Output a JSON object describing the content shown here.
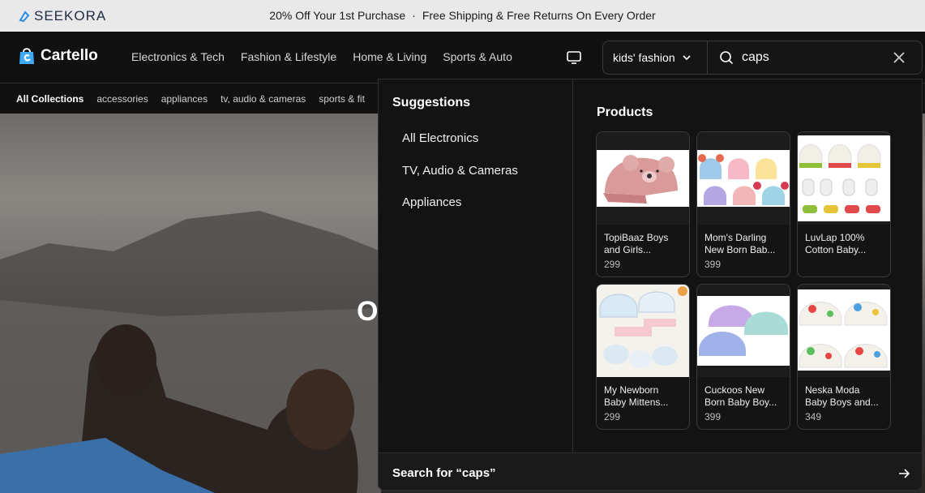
{
  "announcement": {
    "brand": "SEEKORA",
    "promo": "20% Off Your 1st Purchase",
    "separator": "·",
    "shipping": "Free Shipping & Free Returns On Every Order"
  },
  "header": {
    "brand": "Cartello",
    "nav": [
      "Electronics & Tech",
      "Fashion & Lifestyle",
      "Home & Living",
      "Sports & Auto"
    ],
    "category_select": "kids' fashion",
    "search_value": "caps"
  },
  "subnav": [
    "All Collections",
    "accessories",
    "appliances",
    "tv, audio & cameras",
    "sports & fit"
  ],
  "hero": {
    "visible_text": "O"
  },
  "dropdown": {
    "suggestions_title": "Suggestions",
    "suggestions": [
      "All Electronics",
      "TV, Audio & Cameras",
      "Appliances"
    ],
    "products_title": "Products",
    "products": [
      {
        "name": "TopiBaaz Boys and Girls...",
        "price": "299"
      },
      {
        "name": "Mom's Darling New Born Bab...",
        "price": "399"
      },
      {
        "name": "LuvLap 100% Cotton Baby...",
        "price": ""
      },
      {
        "name": "My Newborn Baby Mittens...",
        "price": "299"
      },
      {
        "name": "Cuckoos New Born Baby Boy...",
        "price": "399"
      },
      {
        "name": "Neska Moda Baby Boys and...",
        "price": "349"
      }
    ],
    "search_for": "Search for “caps”"
  },
  "colors": {
    "bg": "#111111",
    "announce_bg": "#e9e9e9",
    "accent": "#3fa9f5"
  }
}
